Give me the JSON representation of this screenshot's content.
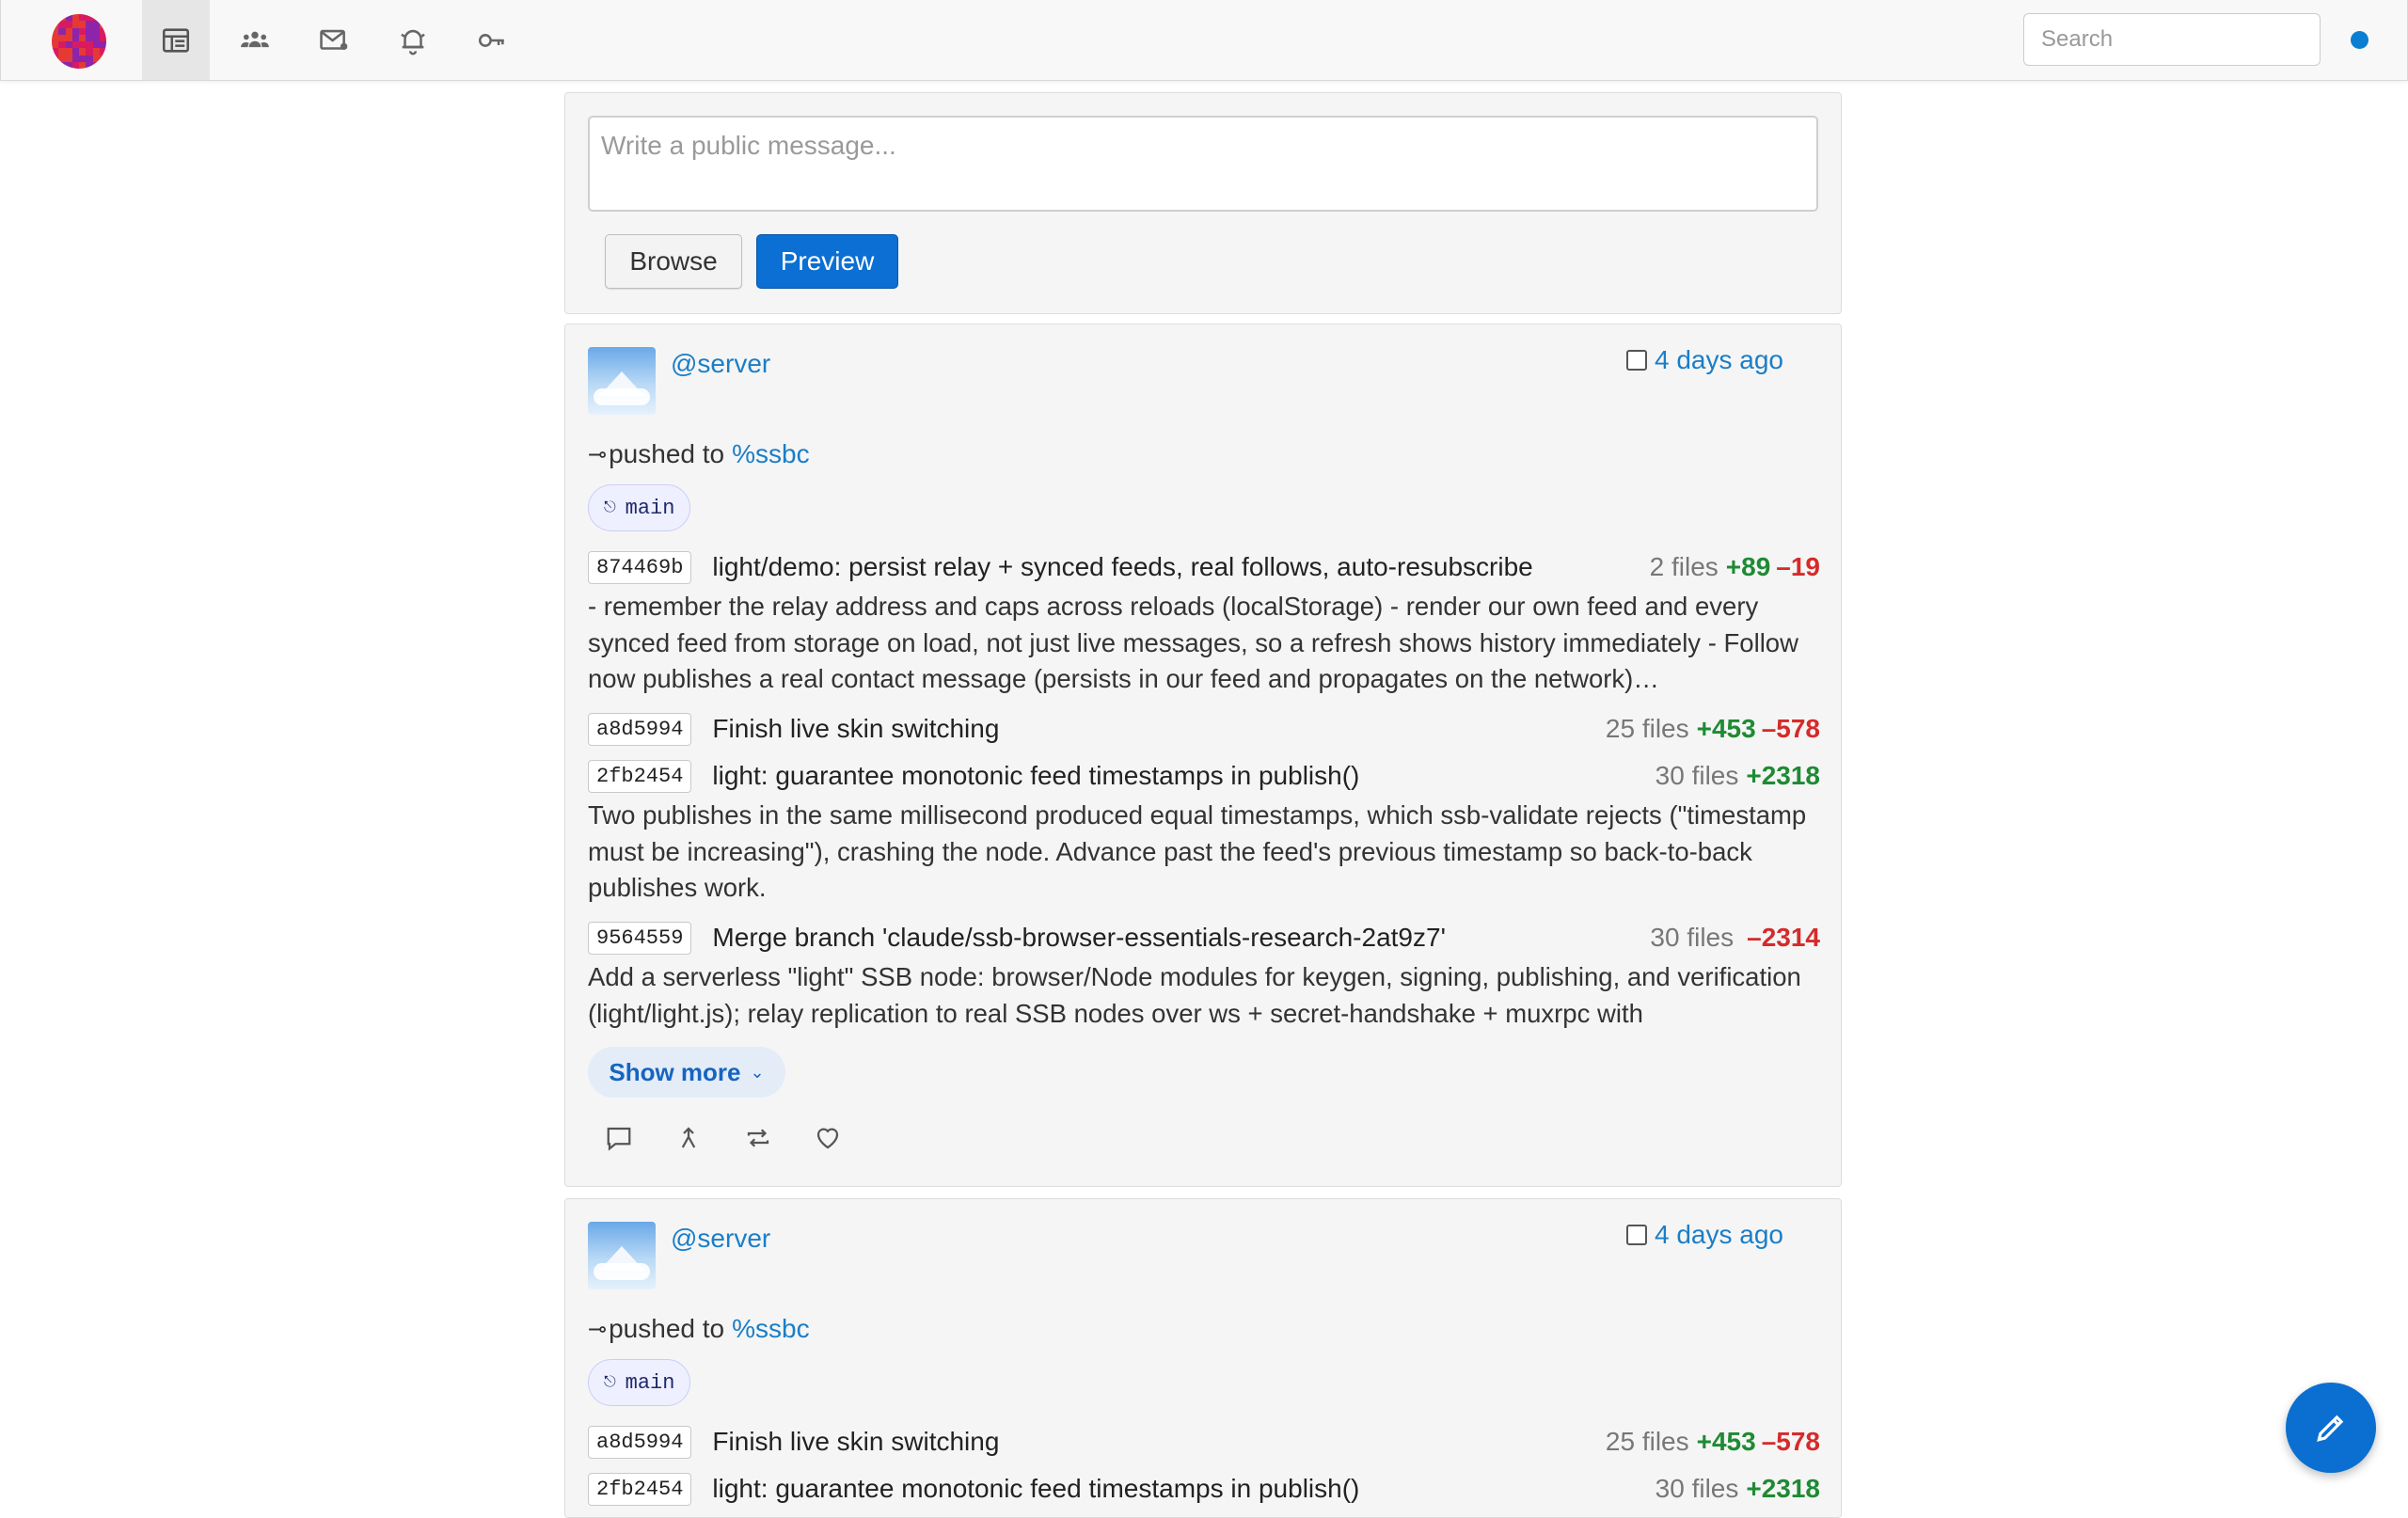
{
  "nav": {
    "items": [
      {
        "icon": "feed-icon",
        "active": true
      },
      {
        "icon": "people-icon",
        "active": false
      },
      {
        "icon": "mail-icon",
        "active": false
      },
      {
        "icon": "bell-icon",
        "active": false
      },
      {
        "icon": "key-icon",
        "active": false
      }
    ],
    "search_placeholder": "Search",
    "status_color": "#0a7fd1"
  },
  "composer": {
    "placeholder": "Write a public message...",
    "browse_label": "Browse",
    "preview_label": "Preview"
  },
  "posts": [
    {
      "author": "@server",
      "timestamp": "4 days ago",
      "pushed_label": "pushed to",
      "repo": "%ssbc",
      "branch": "main",
      "commits": [
        {
          "hash": "874469b",
          "subject": "light/demo: persist relay + synced feeds, real follows, auto-resubscribe",
          "files": "2 files",
          "additions": "+89",
          "deletions": "–19",
          "body": "- remember the relay address and caps across reloads (localStorage) - render our own feed and every synced feed from storage on load, not just live messages, so a refresh shows history immediately - Follow now publishes a real contact message (persists in our feed and propagates on the network)…"
        },
        {
          "hash": "a8d5994",
          "subject": "Finish live skin switching",
          "files": "25 files",
          "additions": "+453",
          "deletions": "–578"
        },
        {
          "hash": "2fb2454",
          "subject": "light: guarantee monotonic feed timestamps in publish()",
          "files": "30 files",
          "additions": "+2318",
          "body": "Two publishes in the same millisecond produced equal timestamps, which ssb-validate rejects (\"timestamp must be increasing\"), crashing the node. Advance past the feed's previous timestamp so back-to-back publishes work."
        },
        {
          "hash": "9564559",
          "subject": "Merge branch 'claude/ssb-browser-essentials-research-2at9z7'",
          "files": "30 files",
          "deletions": "–2314",
          "body": "Add a serverless \"light\" SSB node: browser/Node modules for keygen, signing, publishing, and verification (light/light.js); relay replication to real SSB nodes over ws + secret-handshake + muxrpc with"
        }
      ],
      "show_more": "Show more",
      "actions": [
        "comment-icon",
        "fork-icon",
        "repost-icon",
        "heart-icon"
      ]
    },
    {
      "author": "@server",
      "timestamp": "4 days ago",
      "pushed_label": "pushed to",
      "repo": "%ssbc",
      "branch": "main",
      "commits": [
        {
          "hash": "a8d5994",
          "subject": "Finish live skin switching",
          "files": "25 files",
          "additions": "+453",
          "deletions": "–578"
        },
        {
          "hash": "2fb2454",
          "subject": "light: guarantee monotonic feed timestamps in publish()",
          "files": "30 files",
          "additions": "+2318"
        }
      ]
    }
  ],
  "fab": {
    "icon": "pencil-icon",
    "color": "#0a6fd1"
  }
}
